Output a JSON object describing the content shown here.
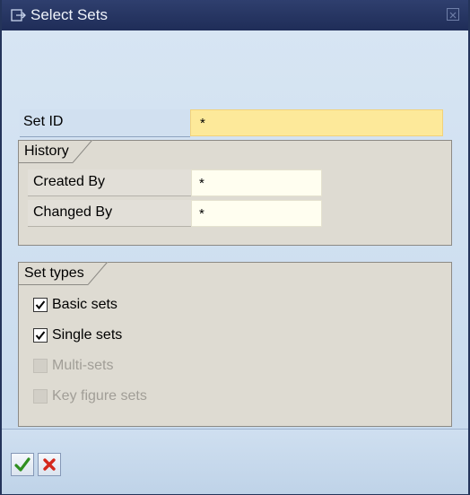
{
  "window": {
    "title": "Select Sets"
  },
  "set_id": {
    "label": "Set ID",
    "value": "*"
  },
  "history": {
    "title": "History",
    "created_by": {
      "label": "Created By",
      "value": "*"
    },
    "changed_by": {
      "label": "Changed By",
      "value": "*"
    }
  },
  "set_types": {
    "title": "Set types",
    "options": [
      {
        "label": "Basic sets",
        "checked": true,
        "enabled": true
      },
      {
        "label": "Single sets",
        "checked": true,
        "enabled": true
      },
      {
        "label": "Multi-sets",
        "checked": false,
        "enabled": false
      },
      {
        "label": "Key figure sets",
        "checked": false,
        "enabled": false
      }
    ]
  },
  "footer": {
    "confirm_icon": "checkmark-icon",
    "cancel_icon": "cancel-icon"
  },
  "colors": {
    "titlebar": "#1f2d58",
    "required_field": "#fde99a",
    "confirm": "#2f8f1f",
    "cancel": "#d4281c"
  }
}
